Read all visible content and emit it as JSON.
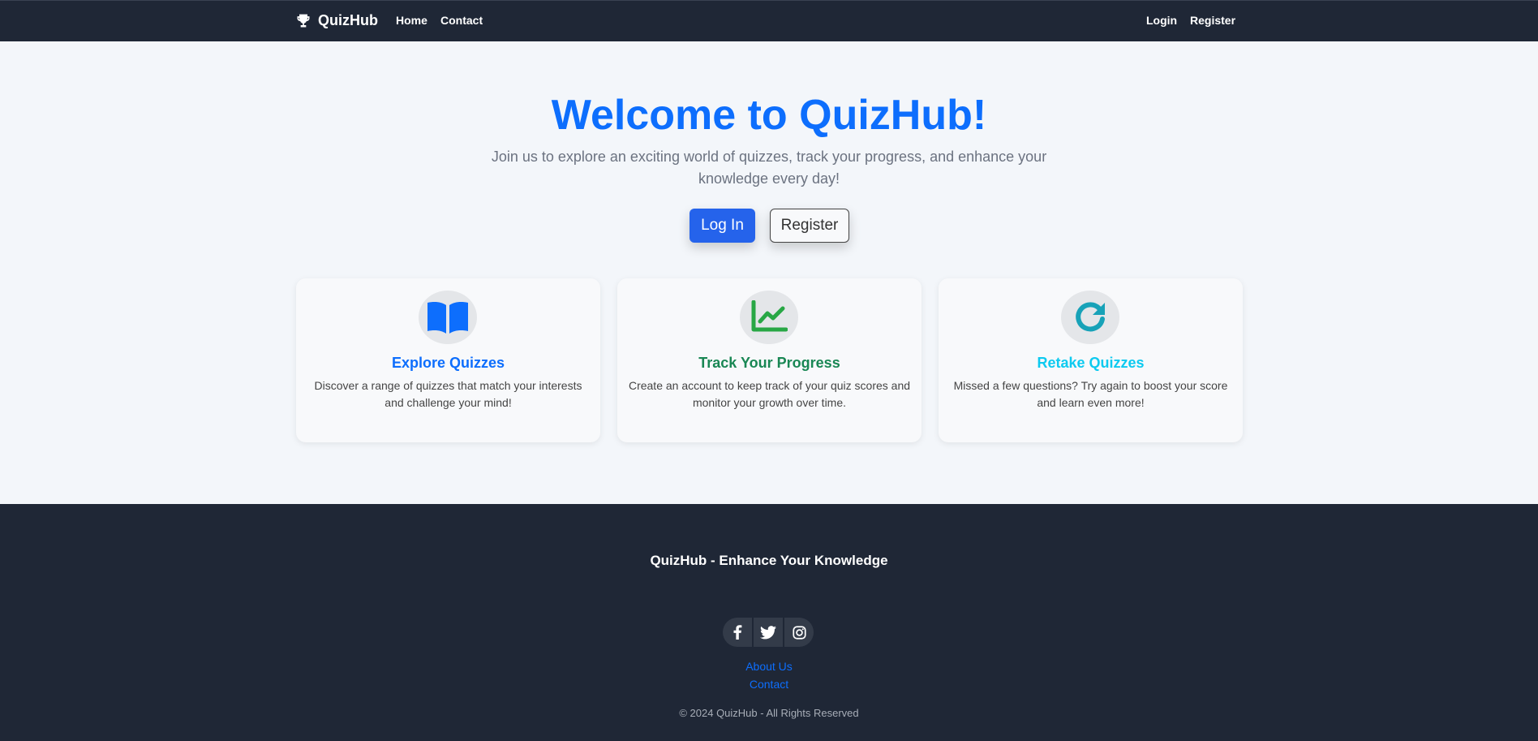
{
  "navbar": {
    "brand": "QuizHub",
    "brand_icon": "trophy-icon",
    "links": {
      "home": "Home",
      "contact": "Contact",
      "login": "Login",
      "register": "Register"
    }
  },
  "hero": {
    "title": "Welcome to QuizHub!",
    "subtitle": "Join us to explore an exciting world of quizzes, track your progress, and enhance your knowledge every day!",
    "login_button": "Log In",
    "register_button": "Register"
  },
  "features": [
    {
      "icon": "book-open-icon",
      "title": "Explore Quizzes",
      "description": "Discover a range of quizzes that match your interests and challenge your mind!",
      "color": "#0d6efd"
    },
    {
      "icon": "chart-line-icon",
      "title": "Track Your Progress",
      "description": "Create an account to keep track of your quiz scores and monitor your growth over time.",
      "color": "#198754"
    },
    {
      "icon": "redo-icon",
      "title": "Retake Quizzes",
      "description": "Missed a few questions? Try again to boost your score and learn even more!",
      "color": "#0dcaf0"
    }
  ],
  "footer": {
    "title": "QuizHub - Enhance Your Knowledge",
    "social": [
      "facebook-icon",
      "twitter-icon",
      "instagram-icon"
    ],
    "links": {
      "about": "About Us",
      "contact": "Contact"
    },
    "copyright": "© 2024 QuizHub - All Rights Reserved"
  },
  "colors": {
    "navbar_bg": "#1f2736",
    "page_bg": "#f3f6fa",
    "primary": "#0d6efd",
    "success": "#198754",
    "info": "#0dcaf0"
  }
}
